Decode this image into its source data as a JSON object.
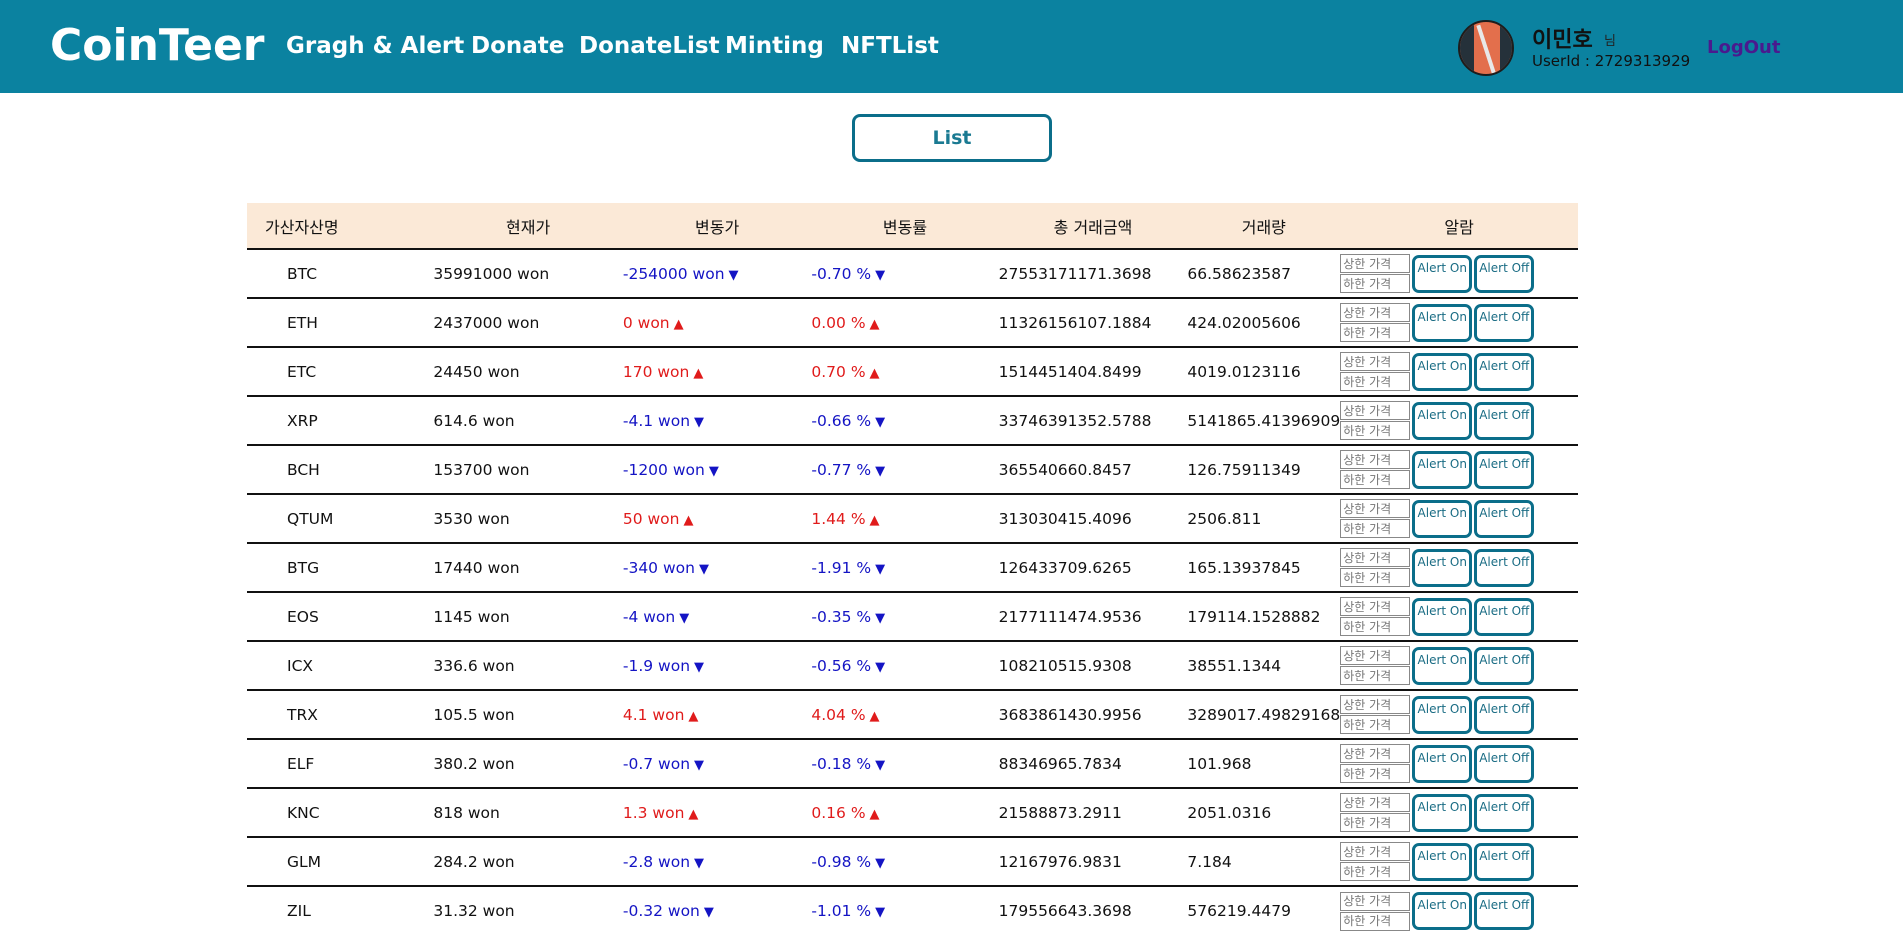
{
  "header": {
    "brand": "CoinTeer",
    "nav": [
      "Gragh & Alert",
      "Donate",
      "DonateList",
      "Minting",
      "NFTList"
    ],
    "user_name": "이민호",
    "user_suffix": "님",
    "user_id": "UserId : 2729313929",
    "logout": "LogOut"
  },
  "list_button": "List",
  "table": {
    "columns": [
      "가산자산명",
      "현재가",
      "변동가",
      "변동률",
      "총 거래금액",
      "거래량",
      "알람"
    ],
    "upper_placeholder": "상한 가격",
    "lower_placeholder": "하한 가격",
    "alert_on": "Alert On",
    "alert_off": "Alert Off",
    "rows": [
      {
        "name": "BTC",
        "price": "35991000 won",
        "change": "-254000 won",
        "rate": "-0.70 %",
        "dir": "down",
        "amount": "27553171171.3698",
        "volume": "66.58623587"
      },
      {
        "name": "ETH",
        "price": "2437000 won",
        "change": "0 won",
        "rate": "0.00 %",
        "dir": "up",
        "amount": "11326156107.1884",
        "volume": "424.02005606"
      },
      {
        "name": "ETC",
        "price": "24450 won",
        "change": "170 won",
        "rate": "0.70 %",
        "dir": "up",
        "amount": "1514451404.8499",
        "volume": "4019.0123116"
      },
      {
        "name": "XRP",
        "price": "614.6 won",
        "change": "-4.1 won",
        "rate": "-0.66 %",
        "dir": "down",
        "amount": "33746391352.5788",
        "volume": "5141865.41396909"
      },
      {
        "name": "BCH",
        "price": "153700 won",
        "change": "-1200 won",
        "rate": "-0.77 %",
        "dir": "down",
        "amount": "365540660.8457",
        "volume": "126.75911349"
      },
      {
        "name": "QTUM",
        "price": "3530 won",
        "change": "50 won",
        "rate": "1.44 %",
        "dir": "up",
        "amount": "313030415.4096",
        "volume": "2506.811"
      },
      {
        "name": "BTG",
        "price": "17440 won",
        "change": "-340 won",
        "rate": "-1.91 %",
        "dir": "down",
        "amount": "126433709.6265",
        "volume": "165.13937845"
      },
      {
        "name": "EOS",
        "price": "1145 won",
        "change": "-4 won",
        "rate": "-0.35 %",
        "dir": "down",
        "amount": "2177111474.9536",
        "volume": "179114.1528882"
      },
      {
        "name": "ICX",
        "price": "336.6 won",
        "change": "-1.9 won",
        "rate": "-0.56 %",
        "dir": "down",
        "amount": "108210515.9308",
        "volume": "38551.1344"
      },
      {
        "name": "TRX",
        "price": "105.5 won",
        "change": "4.1 won",
        "rate": "4.04 %",
        "dir": "up",
        "amount": "3683861430.9956",
        "volume": "3289017.49829168"
      },
      {
        "name": "ELF",
        "price": "380.2 won",
        "change": "-0.7 won",
        "rate": "-0.18 %",
        "dir": "down",
        "amount": "88346965.7834",
        "volume": "101.968"
      },
      {
        "name": "KNC",
        "price": "818 won",
        "change": "1.3 won",
        "rate": "0.16 %",
        "dir": "up",
        "amount": "21588873.2911",
        "volume": "2051.0316"
      },
      {
        "name": "GLM",
        "price": "284.2 won",
        "change": "-2.8 won",
        "rate": "-0.98 %",
        "dir": "down",
        "amount": "12167976.9831",
        "volume": "7.184"
      },
      {
        "name": "ZIL",
        "price": "31.32 won",
        "change": "-0.32 won",
        "rate": "-1.01 %",
        "dir": "down",
        "amount": "179556643.3698",
        "volume": "576219.4479"
      }
    ]
  },
  "colors": {
    "navbar": "#0b82a0",
    "up": "#e01b1b",
    "down": "#1414c4",
    "header_row": "#fbe9d7"
  }
}
